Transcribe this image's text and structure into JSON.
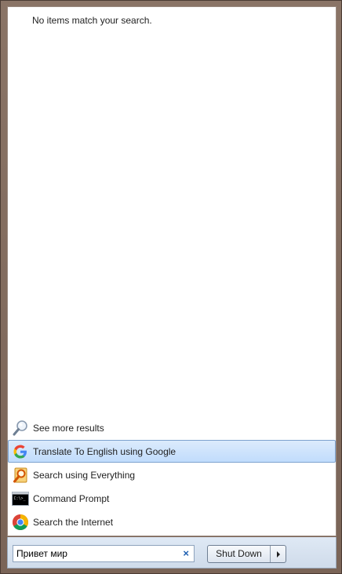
{
  "empty_message": "No items match your search.",
  "results": [
    {
      "label": "See more results",
      "icon": "magnifier-icon",
      "selected": false
    },
    {
      "label": "Translate To English using Google",
      "icon": "google-g-icon",
      "selected": true
    },
    {
      "label": "Search using Everything",
      "icon": "everything-search-icon",
      "selected": false
    },
    {
      "label": "Command Prompt",
      "icon": "command-prompt-icon",
      "selected": false
    },
    {
      "label": "Search the Internet",
      "icon": "chrome-icon",
      "selected": false
    }
  ],
  "search": {
    "value": "Привет мир",
    "clear_symbol": "×"
  },
  "shutdown": {
    "label": "Shut Down"
  }
}
